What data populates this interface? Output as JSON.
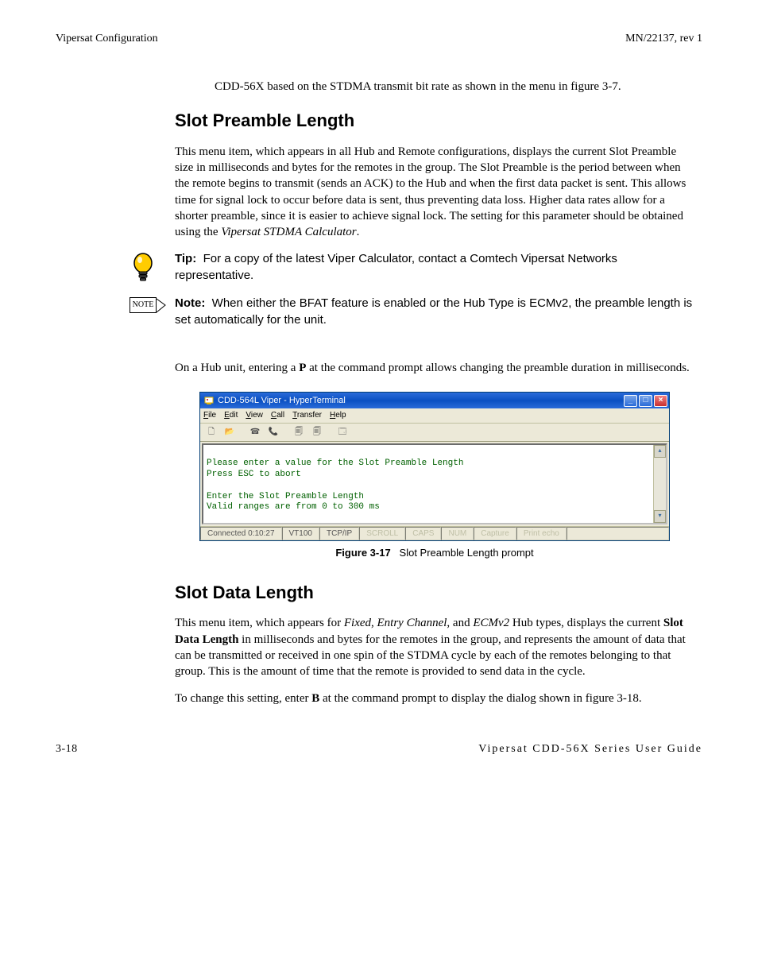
{
  "header": {
    "left": "Vipersat Configuration",
    "right": "MN/22137, rev 1"
  },
  "intro_tail": "CDD-56X based on the STDMA transmit bit rate as shown in the menu in figure 3-7.",
  "section1": {
    "title": "Slot Preamble Length",
    "para": "This menu item, which appears in all Hub and Remote configurations, displays the current Slot Preamble size in milliseconds and bytes for the remotes in the group. The Slot Preamble is the period between when the remote begins to transmit (sends an ACK) to the Hub and when the first data packet is sent. This allows time for signal lock to occur before data is sent, thus preventing data loss. Higher data rates allow for a shorter preamble, since it is easier to achieve signal lock. The setting for this parameter should be obtained using the ",
    "para_em": "Vipersat STDMA Calculator",
    "para_end": ".",
    "tip_label": "Tip:",
    "tip_text": "For a copy of the latest Viper Calculator, contact a Comtech Vipersat Networks representative.",
    "note_box": "NOTE",
    "note_label": "Note:",
    "note_text": "When either the BFAT feature is enabled or the Hub Type is ECMv2, the preamble length is set automatically for the unit.",
    "para2_a": "On a Hub unit, entering a ",
    "para2_b": "P",
    "para2_c": " at the command prompt allows changing the preamble duration in milliseconds."
  },
  "hyperterminal": {
    "title": "CDD-564L Viper - HyperTerminal",
    "menu": [
      "File",
      "Edit",
      "View",
      "Call",
      "Transfer",
      "Help"
    ],
    "term_lines": "\nPlease enter a value for the Slot Preamble Length\nPress ESC to abort\n\nEnter the Slot Preamble Length\nValid ranges are from 0 to 300 ms",
    "status": {
      "connected": "Connected 0:10:27",
      "emul": "VT100",
      "proto": "TCP/IP",
      "scroll": "SCROLL",
      "caps": "CAPS",
      "num": "NUM",
      "capture": "Capture",
      "echo": "Print echo"
    }
  },
  "fig_caption_b": "Figure 3-17",
  "fig_caption_t": "Slot Preamble Length prompt",
  "section2": {
    "title": "Slot Data Length",
    "para_a": "This menu item, which appears for ",
    "em1": "Fixed",
    "c1": ", ",
    "em2": "Entry Channel",
    "c2": ", and ",
    "em3": "ECMv2",
    "para_b": " Hub types, displays the current ",
    "bold1": "Slot Data Length",
    "para_c": " in milliseconds and bytes for the remotes in the group, and represents the amount of data that can be transmitted or received in one spin of the STDMA cycle by each of the remotes belonging to that group. This is the amount of time that the remote is provided to send data in the cycle.",
    "para2_a": "To change this setting, enter ",
    "para2_b": "B",
    "para2_c": " at the command prompt to display the dialog shown in figure 3-18."
  },
  "footer": {
    "left": "3-18",
    "right": "Vipersat CDD-56X Series User Guide"
  }
}
